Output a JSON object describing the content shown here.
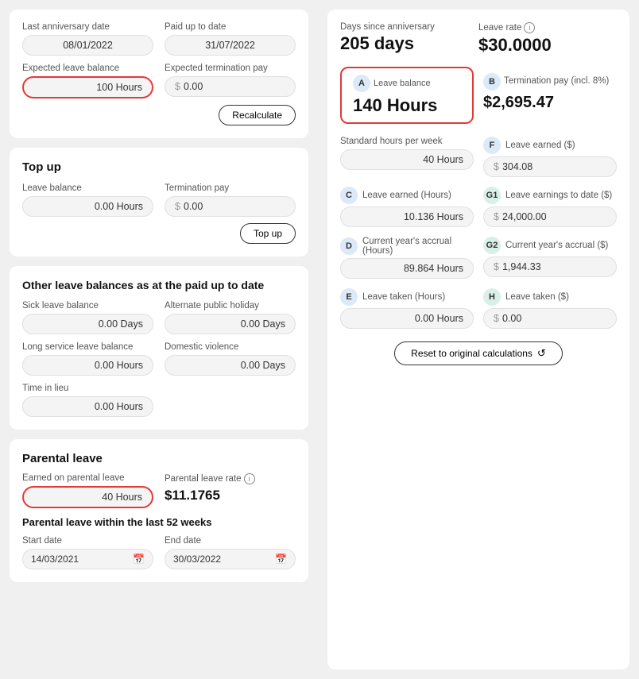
{
  "left": {
    "topSection": {
      "lastAnniversaryDate": {
        "label": "Last anniversary date",
        "value": "08/01/2022"
      },
      "paidUpToDate": {
        "label": "Paid up to date",
        "value": "31/07/2022"
      },
      "expectedLeaveBalance": {
        "label": "Expected leave balance",
        "value": "100 Hours",
        "highlighted": true
      },
      "expectedTerminationPay": {
        "label": "Expected termination pay",
        "dollarSymbol": "$",
        "value": "0.00"
      },
      "recalculateBtn": "Recalculate"
    },
    "topUp": {
      "title": "Top up",
      "leaveBalance": {
        "label": "Leave balance",
        "value": "0.00 Hours"
      },
      "terminationPay": {
        "label": "Termination pay",
        "dollarSymbol": "$",
        "value": "0.00"
      },
      "topUpBtn": "Top up"
    },
    "otherLeave": {
      "title": "Other leave balances as at the paid up to date",
      "fields": [
        {
          "label": "Sick leave balance",
          "value": "0.00 Days"
        },
        {
          "label": "Alternate public holiday",
          "value": "0.00 Days"
        },
        {
          "label": "Long service leave balance",
          "value": "0.00 Hours"
        },
        {
          "label": "Domestic violence",
          "value": "0.00 Days"
        },
        {
          "label": "Time in lieu",
          "value": "0.00 Hours"
        },
        {
          "label": "",
          "value": ""
        }
      ]
    },
    "parentalLeave": {
      "title": "Parental leave",
      "earnedOnParentalLeave": {
        "label": "Earned on parental leave",
        "value": "40 Hours",
        "highlighted": true
      },
      "parentalLeaveRate": {
        "label": "Parental leave rate",
        "value": "$11.1765"
      },
      "withinLabel": "Parental leave within the last 52 weeks",
      "startDate": {
        "label": "Start date",
        "value": "14/03/2021"
      },
      "endDate": {
        "label": "End date",
        "value": "30/03/2022"
      }
    }
  },
  "right": {
    "daysSinceAnniversary": {
      "label": "Days since anniversary",
      "value": "205 days"
    },
    "leaveRate": {
      "label": "Leave rate",
      "value": "$30.0000"
    },
    "leaveBalance": {
      "badgeLetter": "A",
      "label": "Leave balance",
      "value": "140 Hours"
    },
    "terminationPay": {
      "badgeLetter": "B",
      "label": "Termination pay (incl. 8%)",
      "value": "$2,695.47"
    },
    "standardHoursPerWeek": {
      "label": "Standard hours per week",
      "value": "40 Hours"
    },
    "leaveEarnedDollars": {
      "badgeLetter": "F",
      "label": "Leave earned ($)",
      "dollarSymbol": "$",
      "value": "304.08"
    },
    "leaveEarnedHours": {
      "badgeLetter": "C",
      "label": "Leave earned (Hours)",
      "value": "10.136 Hours"
    },
    "leaveEarningsToDate": {
      "badgeLetter": "G1",
      "label": "Leave earnings to date ($)",
      "dollarSymbol": "$",
      "value": "24,000.00"
    },
    "currentYearAccrualHours": {
      "badgeLetter": "D",
      "label": "Current year's accrual (Hours)",
      "value": "89.864 Hours"
    },
    "currentYearAccrualDollars": {
      "badgeLetter": "G2",
      "label": "Current year's accrual ($)",
      "dollarSymbol": "$",
      "value": "1,944.33"
    },
    "leaveTakenHours": {
      "badgeLetter": "E",
      "label": "Leave taken (Hours)",
      "value": "0.00 Hours"
    },
    "leaveTakenDollars": {
      "badgeLetter": "H",
      "label": "Leave taken ($)",
      "dollarSymbol": "$",
      "value": "0.00"
    },
    "resetBtn": "Reset to original calculations"
  }
}
